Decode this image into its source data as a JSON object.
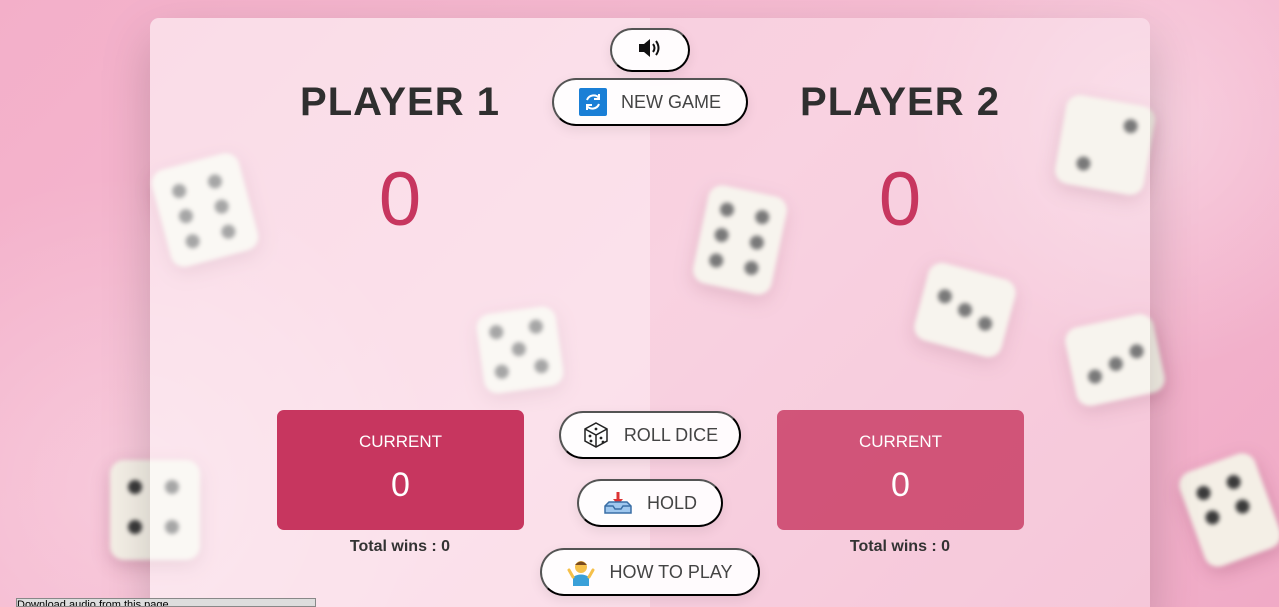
{
  "players": [
    {
      "name": "PLAYER 1",
      "score": "0",
      "current_label": "CURRENT",
      "current_score": "0",
      "wins": "Total wins : 0"
    },
    {
      "name": "PLAYER 2",
      "score": "0",
      "current_label": "CURRENT",
      "current_score": "0",
      "wins": "Total wins : 0"
    }
  ],
  "buttons": {
    "sound_icon": "speaker-icon",
    "new_game": "NEW GAME",
    "roll_dice": "ROLL DICE",
    "hold": "HOLD",
    "how_to_play": "HOW TO PLAY"
  },
  "bottom_bar": {
    "text": "Download audio from this page"
  },
  "colors": {
    "accent": "#c7365f",
    "background": "#f5b6cf"
  }
}
